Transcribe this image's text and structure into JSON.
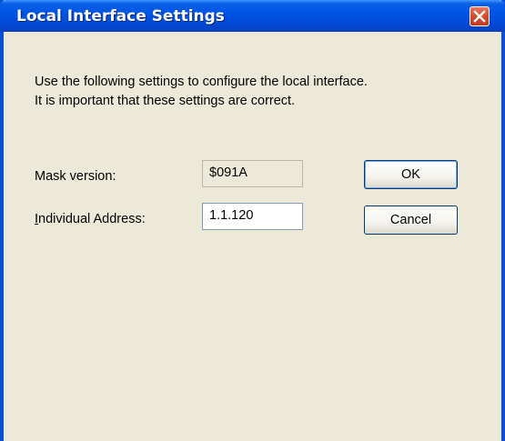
{
  "window": {
    "title": "Local Interface Settings"
  },
  "instructions": {
    "line1": "Use the following settings to configure the local interface.",
    "line2": "It is important that these settings are correct."
  },
  "fields": {
    "mask_version": {
      "label": "Mask version:",
      "value": "$091A"
    },
    "individual_address": {
      "label_mnemonic": "I",
      "label_rest": "ndividual Address:",
      "value": "1.1.120"
    }
  },
  "buttons": {
    "ok_label": "OK",
    "cancel_label": "Cancel"
  },
  "colors": {
    "titlebar": "#0055e5",
    "dialog_background": "#ece9d8",
    "close_button": "#d8492a"
  },
  "icons": {
    "close": "close-icon"
  }
}
